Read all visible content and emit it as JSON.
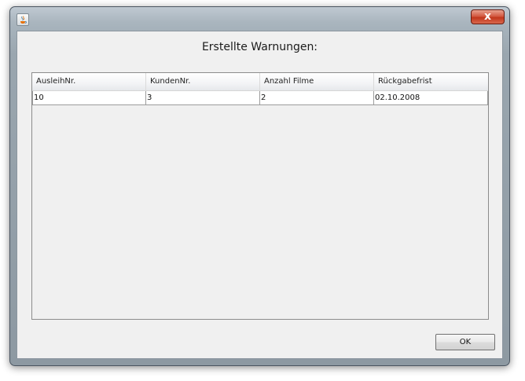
{
  "window": {
    "title": "",
    "close_glyph": "x",
    "icon": "java-coffee-cup-icon"
  },
  "dialog": {
    "heading": "Erstellte Warnungen:"
  },
  "table": {
    "columns": [
      "AusleihNr.",
      "KundenNr.",
      "Anzahl Filme",
      "Rückgabefrist"
    ],
    "rows": [
      [
        "10",
        "3",
        "2",
        "02.10.2008"
      ]
    ]
  },
  "buttons": {
    "ok_label": "OK"
  },
  "colors": {
    "close_button": "#c1361c",
    "client_background": "#f0f0f0",
    "table_border": "#8c8c8c"
  }
}
